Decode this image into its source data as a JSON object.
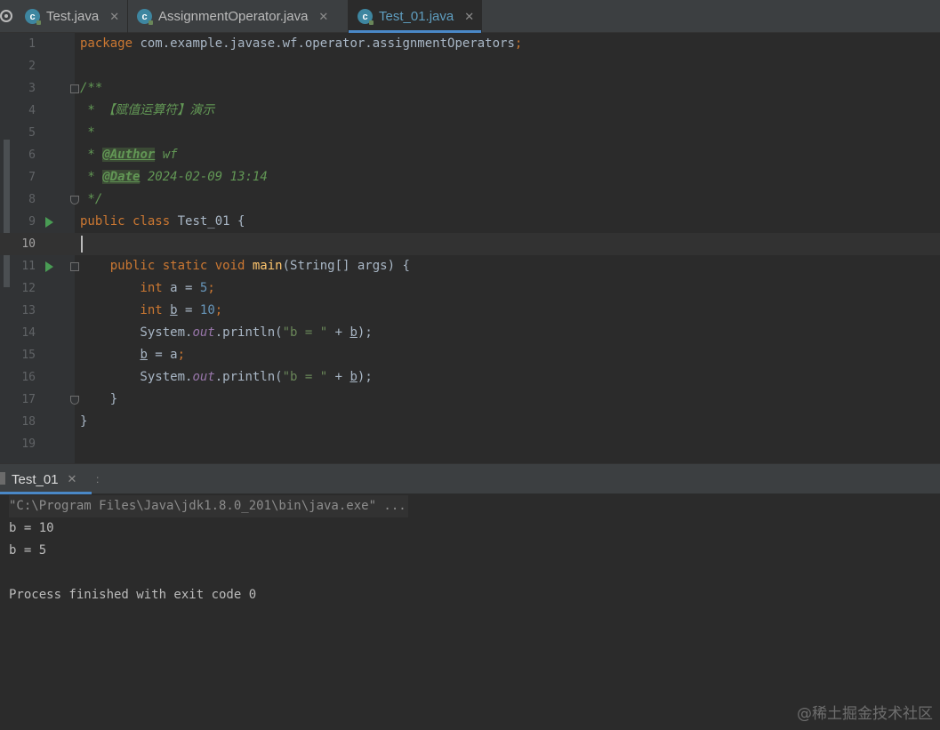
{
  "tabs": [
    {
      "label": "Test.java",
      "active": false
    },
    {
      "label": "AssignmentOperator.java",
      "active": false
    },
    {
      "label": "Test_01.java",
      "active": true
    }
  ],
  "icons": {
    "file": "java-class-icon",
    "close": "close-icon",
    "run": "run-gutter-icon",
    "fold": "fold-icon"
  },
  "editor": {
    "current_line": 10,
    "lines": [
      {
        "n": "1",
        "segments": [
          {
            "t": "package",
            "c": "kw"
          },
          {
            "t": " com.example.javase.wf.operator.assignmentOperators",
            "c": "pkg"
          },
          {
            "t": ";",
            "c": "kw"
          }
        ]
      },
      {
        "n": "2",
        "segments": []
      },
      {
        "n": "3",
        "segments": [
          {
            "t": "/**",
            "c": "doc"
          }
        ]
      },
      {
        "n": "4",
        "segments": [
          {
            "t": " * 【赋值运算符】演示",
            "c": "doc"
          }
        ]
      },
      {
        "n": "5",
        "segments": [
          {
            "t": " *",
            "c": "doc"
          }
        ]
      },
      {
        "n": "6",
        "segments": [
          {
            "t": " * ",
            "c": "doc"
          },
          {
            "t": "@Author",
            "c": "tag"
          },
          {
            "t": " wf",
            "c": "doc"
          }
        ]
      },
      {
        "n": "7",
        "segments": [
          {
            "t": " * ",
            "c": "doc"
          },
          {
            "t": "@Date",
            "c": "tag"
          },
          {
            "t": " 2024-02-09 13:14",
            "c": "doc"
          }
        ]
      },
      {
        "n": "8",
        "segments": [
          {
            "t": " */",
            "c": "doc"
          }
        ]
      },
      {
        "n": "9",
        "segments": [
          {
            "t": "public class",
            "c": "kw"
          },
          {
            "t": " Test_01 {",
            "c": "cls"
          }
        ]
      },
      {
        "n": "10",
        "segments": []
      },
      {
        "n": "11",
        "segments": [
          {
            "t": "    public static void",
            "c": "kw"
          },
          {
            "t": " ",
            "c": "cls"
          },
          {
            "t": "main",
            "c": "mth"
          },
          {
            "t": "(String[] args) {",
            "c": "cls"
          }
        ]
      },
      {
        "n": "12",
        "segments": [
          {
            "t": "        int",
            "c": "kw"
          },
          {
            "t": " a = ",
            "c": "cls"
          },
          {
            "t": "5",
            "c": "num"
          },
          {
            "t": ";",
            "c": "kw"
          }
        ]
      },
      {
        "n": "13",
        "segments": [
          {
            "t": "        int",
            "c": "kw"
          },
          {
            "t": " ",
            "c": "cls"
          },
          {
            "t": "b",
            "c": "ul"
          },
          {
            "t": " = ",
            "c": "cls"
          },
          {
            "t": "10",
            "c": "num"
          },
          {
            "t": ";",
            "c": "kw"
          }
        ]
      },
      {
        "n": "14",
        "segments": [
          {
            "t": "        System.",
            "c": "cls"
          },
          {
            "t": "out",
            "c": "fld"
          },
          {
            "t": ".println(",
            "c": "cls"
          },
          {
            "t": "\"b = \"",
            "c": "str"
          },
          {
            "t": " + ",
            "c": "cls"
          },
          {
            "t": "b",
            "c": "ul"
          },
          {
            "t": ");",
            "c": "cls"
          }
        ]
      },
      {
        "n": "15",
        "segments": [
          {
            "t": "        ",
            "c": "cls"
          },
          {
            "t": "b",
            "c": "ul"
          },
          {
            "t": " = a",
            "c": "cls"
          },
          {
            "t": ";",
            "c": "kw"
          }
        ]
      },
      {
        "n": "16",
        "segments": [
          {
            "t": "        System.",
            "c": "cls"
          },
          {
            "t": "out",
            "c": "fld"
          },
          {
            "t": ".println(",
            "c": "cls"
          },
          {
            "t": "\"b = \"",
            "c": "str"
          },
          {
            "t": " + ",
            "c": "cls"
          },
          {
            "t": "b",
            "c": "ul"
          },
          {
            "t": ");",
            "c": "cls"
          }
        ]
      },
      {
        "n": "17",
        "segments": [
          {
            "t": "    }",
            "c": "cls"
          }
        ]
      },
      {
        "n": "18",
        "segments": [
          {
            "t": "}",
            "c": "cls"
          }
        ]
      },
      {
        "n": "19",
        "segments": []
      }
    ]
  },
  "run_panel": {
    "tab_label": "Test_01",
    "extra_mark": ":",
    "output": [
      {
        "text": "\"C:\\Program Files\\Java\\jdk1.8.0_201\\bin\\java.exe\" ...",
        "type": "cmd"
      },
      {
        "text": "b = 10",
        "type": "out"
      },
      {
        "text": "b = 5",
        "type": "out"
      },
      {
        "text": "",
        "type": "out"
      },
      {
        "text": "Process finished with exit code 0",
        "type": "out"
      }
    ]
  },
  "watermark": "@稀土掘金技术社区",
  "colors": {
    "background": "#2b2b2b",
    "keyword": "#cc7832",
    "doc_comment": "#629755",
    "string": "#6a8759",
    "number": "#6897bb",
    "method": "#ffc66d",
    "field": "#9876aa",
    "accent": "#4a88c7"
  }
}
